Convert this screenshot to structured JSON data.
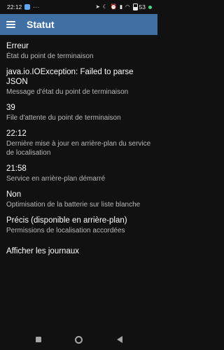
{
  "status_bar": {
    "time": "22:12",
    "overflow": "···",
    "battery": "53",
    "icons": [
      "location-icon",
      "dnd-icon",
      "alarm-icon",
      "signal-icon",
      "wifi-icon",
      "battery-icon"
    ]
  },
  "app_bar": {
    "title": "Statut",
    "menu_icon": "hamburger-menu-icon",
    "color": "#3f6fa3"
  },
  "items": [
    {
      "title": "Erreur",
      "subtitle": "État du point de terminaison"
    },
    {
      "title": "java.io.IOException: Failed to parse JSON",
      "subtitle": "Message d'état du point de terminaison"
    },
    {
      "title": "39",
      "subtitle": "File d'attente du point de terminaison"
    },
    {
      "title": "22:12",
      "subtitle": "Dernière mise à jour en arrière-plan du service de localisation"
    },
    {
      "title": "21:58",
      "subtitle": "Service en arrière-plan démarré"
    },
    {
      "title": "Non",
      "subtitle": "Optimisation de la batterie sur liste blanche"
    },
    {
      "title": "Précis (disponible en arrière-plan)",
      "subtitle": "Permissions de localisation accordées"
    }
  ],
  "logs_link": "Afficher les journaux",
  "nav_bar": {
    "icons": [
      "recents-square-icon",
      "home-circle-icon",
      "back-triangle-icon"
    ]
  }
}
